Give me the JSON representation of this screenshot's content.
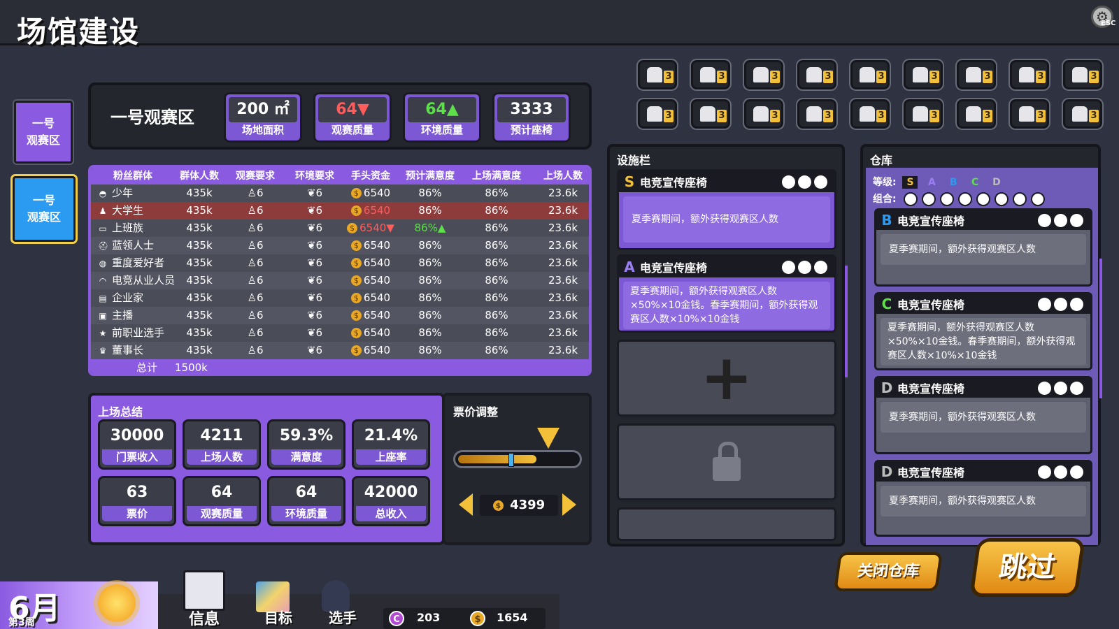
{
  "title": "场馆建设",
  "esc": "ESC",
  "zones": [
    "一号\n观赛区",
    "一号\n观赛区"
  ],
  "info": {
    "name": "一号观赛区",
    "stats": [
      {
        "value": "200 ㎡",
        "label": "场地面积"
      },
      {
        "value": "64▼",
        "label": "观赛质量"
      },
      {
        "value": "64▲",
        "label": "环境质量"
      },
      {
        "value": "3333",
        "label": "预计座椅"
      }
    ]
  },
  "table": {
    "headers": [
      "粉丝群体",
      "群体人数",
      "观赛要求",
      "环境要求",
      "手头资金",
      "预计满意度",
      "上场满意度",
      "上场人数"
    ],
    "rows": [
      {
        "icon": "◓",
        "name": "少年",
        "count": "435k",
        "req": "6",
        "env": "6",
        "fund": "6540",
        "exp": "86%",
        "last": "86%",
        "num": "23.6k"
      },
      {
        "icon": "♟",
        "name": "大学生",
        "count": "435k",
        "req": "6",
        "env": "6",
        "fund": "6540",
        "exp": "86%",
        "last": "86%",
        "num": "23.6k"
      },
      {
        "icon": "▭",
        "name": "上班族",
        "count": "435k",
        "req": "6",
        "env": "6",
        "fund": "6540▼",
        "exp": "86%▲",
        "last": "86%",
        "num": "23.6k"
      },
      {
        "icon": "⛑",
        "name": "蓝领人士",
        "count": "435k",
        "req": "6",
        "env": "6",
        "fund": "6540",
        "exp": "86%",
        "last": "86%",
        "num": "23.6k"
      },
      {
        "icon": "◍",
        "name": "重度爱好者",
        "count": "435k",
        "req": "6",
        "env": "6",
        "fund": "6540",
        "exp": "86%",
        "last": "86%",
        "num": "23.6k"
      },
      {
        "icon": "◠",
        "name": "电竞从业人员",
        "count": "435k",
        "req": "6",
        "env": "6",
        "fund": "6540",
        "exp": "86%",
        "last": "86%",
        "num": "23.6k"
      },
      {
        "icon": "▤",
        "name": "企业家",
        "count": "435k",
        "req": "6",
        "env": "6",
        "fund": "6540",
        "exp": "86%",
        "last": "86%",
        "num": "23.6k"
      },
      {
        "icon": "▣",
        "name": "主播",
        "count": "435k",
        "req": "6",
        "env": "6",
        "fund": "6540",
        "exp": "86%",
        "last": "86%",
        "num": "23.6k"
      },
      {
        "icon": "★",
        "name": "前职业选手",
        "count": "435k",
        "req": "6",
        "env": "6",
        "fund": "6540",
        "exp": "86%",
        "last": "86%",
        "num": "23.6k"
      },
      {
        "icon": "♛",
        "name": "董事长",
        "count": "435k",
        "req": "6",
        "env": "6",
        "fund": "6540",
        "exp": "86%",
        "last": "86%",
        "num": "23.6k"
      }
    ],
    "total_label": "总计",
    "total_value": "1500k",
    "coin_symbol": "$",
    "seat_symbol": "♙",
    "plant_symbol": "❦"
  },
  "summary": {
    "title": "上场总结",
    "cards": [
      {
        "value": "30000",
        "label": "门票收入"
      },
      {
        "value": "4211",
        "label": "上场人数"
      },
      {
        "value": "59.3%",
        "label": "满意度"
      },
      {
        "value": "21.4%",
        "label": "上座率"
      },
      {
        "value": "63",
        "label": "票价"
      },
      {
        "value": "64",
        "label": "观赛质量"
      },
      {
        "value": "64",
        "label": "环境质量"
      },
      {
        "value": "42000",
        "label": "总收入"
      }
    ]
  },
  "price": {
    "title": "票价调整",
    "value": "4399",
    "level": 0.66
  },
  "seats": {
    "count_label": "3",
    "rows": 2,
    "cols": 9
  },
  "facility": {
    "title": "设施栏",
    "cards": [
      {
        "grade": "S",
        "name": "电竞宣传座椅",
        "desc": "夏季赛期间，额外获得观赛区人数"
      },
      {
        "grade": "A",
        "name": "电竞宣传座椅",
        "desc": "夏季赛期间，额外获得观赛区人数×50%×10金钱。春季赛期间，额外获得观赛区人数×10%×10金钱"
      }
    ],
    "add_symbol": "+"
  },
  "warehouse": {
    "title": "仓库",
    "grade_label": "等级:",
    "grades": [
      "S",
      "A",
      "B",
      "C",
      "D"
    ],
    "combo_label": "组合:",
    "cards": [
      {
        "grade": "B",
        "name": "电竞宣传座椅",
        "desc": "夏季赛期间，额外获得观赛区人数"
      },
      {
        "grade": "C",
        "name": "电竞宣传座椅",
        "desc": "夏季赛期间，额外获得观赛区人数×50%×10金钱。春季赛期间，额外获得观赛区人数×10%×10金钱"
      },
      {
        "grade": "D",
        "name": "电竞宣传座椅",
        "desc": "夏季赛期间，额外获得观赛区人数"
      },
      {
        "grade": "D",
        "name": "电竞宣传座椅",
        "desc": "夏季赛期间，额外获得观赛区人数"
      }
    ]
  },
  "buttons": {
    "close_warehouse": "关闭仓库",
    "skip": "跳过"
  },
  "bottom": {
    "month": "6月",
    "week": "第3周",
    "nav": [
      "信息",
      "目标",
      "选手"
    ],
    "c_symbol": "C",
    "c_value": "203",
    "s_symbol": "$",
    "s_value": "1654"
  },
  "colors": {
    "accent": "#8a5ae0",
    "blue": "#2a9bf0",
    "gold": "#f3c03a",
    "red": "#ff5c5c",
    "green": "#5de04a"
  }
}
